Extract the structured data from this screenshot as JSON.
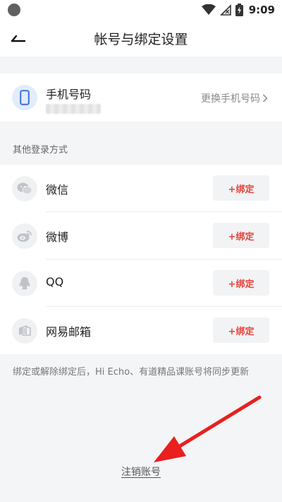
{
  "status_bar": {
    "time": "9:09"
  },
  "nav": {
    "title": "帐号与绑定设置"
  },
  "phone": {
    "label": "手机号码",
    "change_label": "更换手机号码"
  },
  "other_login": {
    "header": "其他登录方式",
    "items": [
      {
        "label": "微信",
        "icon": "wechat-icon",
        "action": "+绑定"
      },
      {
        "label": "微博",
        "icon": "weibo-icon",
        "action": "+绑定"
      },
      {
        "label": "QQ",
        "icon": "qq-icon",
        "action": "+绑定"
      },
      {
        "label": "网易邮箱",
        "icon": "netease-mail-icon",
        "action": "+绑定"
      }
    ]
  },
  "note": "绑定或解除绑定后，Hi Echo、有道精品课账号将同步更新",
  "cancel_account": "注销账号",
  "colors": {
    "accent_red": "#e8453c",
    "annotation_arrow": "#e8201f",
    "phone_icon_bg": "#e3ecfb",
    "phone_icon": "#3b6fd8"
  }
}
